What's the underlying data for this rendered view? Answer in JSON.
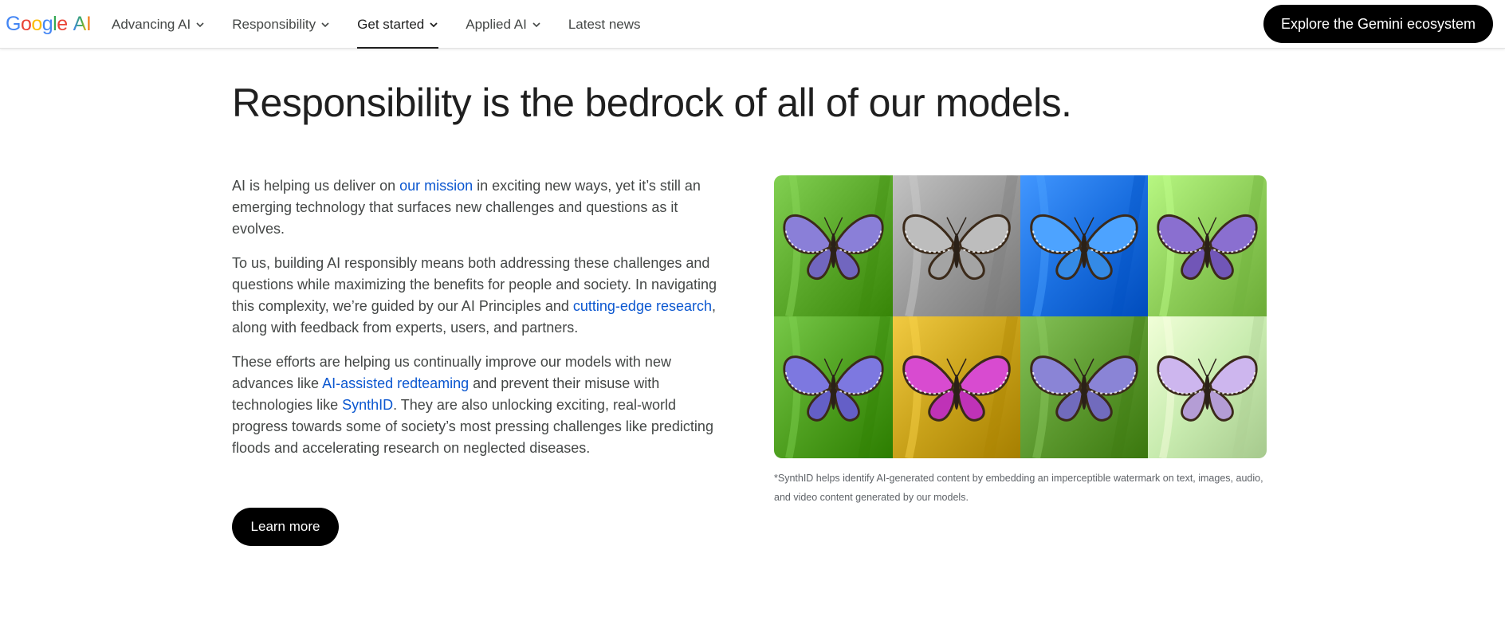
{
  "header": {
    "logo_google": "Google",
    "logo_ai": "AI",
    "nav": [
      {
        "label": "Advancing AI",
        "has_dropdown": true,
        "active": false
      },
      {
        "label": "Responsibility",
        "has_dropdown": true,
        "active": false
      },
      {
        "label": "Get started",
        "has_dropdown": true,
        "active": true
      },
      {
        "label": "Applied AI",
        "has_dropdown": true,
        "active": false
      },
      {
        "label": "Latest news",
        "has_dropdown": false,
        "active": false
      }
    ],
    "cta_label": "Explore the Gemini ecosystem"
  },
  "main": {
    "headline": "Responsibility is the bedrock of all of our models.",
    "p1_before": "AI is helping us deliver on ",
    "p1_link": "our mission",
    "p1_after": " in exciting new ways, yet it’s still an emerging technology that surfaces new challenges and questions as it evolves.",
    "p2_before": "To us, building AI responsibly means both addressing these challenges and questions while maximizing the benefits for people and society. In navigating this complexity, we’re guided by our AI Principles and ",
    "p2_link": "cutting-edge research",
    "p2_after": ", along with feedback from experts, users, and partners.",
    "p3_before": "These efforts are helping us continually improve our models with new advances like ",
    "p3_link1": "AI-assisted redteaming",
    "p3_mid": " and prevent their misuse with technologies like ",
    "p3_link2": "SynthID",
    "p3_after": ". They are also unlocking exciting, real-world progress towards some of society’s most pressing challenges like predicting floods and accelerating research on neglected diseases.",
    "learn_more_label": "Learn more",
    "image_caption": "*SynthID helps identify AI-generated content by embedding an imperceptible watermark on text, images, audio, and video content generated by our models."
  },
  "colors": {
    "link": "#0b57d0",
    "button_bg": "#000000",
    "button_text": "#ffffff",
    "body_text": "#444746",
    "headline": "#1f1f1f"
  },
  "image_tiles": [
    {
      "name": "butterfly-green",
      "bg": "#5aa82a",
      "wing": "#8a7fd8"
    },
    {
      "name": "butterfly-grayscale",
      "bg": "#9a9a9a",
      "wing": "#bdbdbd"
    },
    {
      "name": "butterfly-blue",
      "bg": "#1a6fe0",
      "wing": "#4da3ff"
    },
    {
      "name": "butterfly-pale-green",
      "bg": "#8fcf5a",
      "wing": "#8a6fd0"
    },
    {
      "name": "butterfly-green-2",
      "bg": "#4fa020",
      "wing": "#7d78e0"
    },
    {
      "name": "butterfly-yellow-magenta",
      "bg": "#c9a21a",
      "wing": "#d84bd0"
    },
    {
      "name": "butterfly-textured-green",
      "bg": "#5d9a30",
      "wing": "#8a84d6"
    },
    {
      "name": "butterfly-faded",
      "bg": "#c9ecb0",
      "wing": "#cdb6ee"
    }
  ]
}
